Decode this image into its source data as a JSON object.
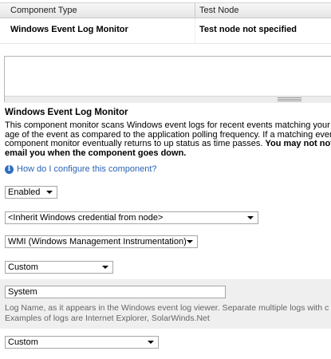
{
  "table": {
    "headers": [
      "Component Type",
      "Test Node"
    ],
    "row": {
      "component_type": "Windows Event Log Monitor",
      "test_node": "Test node not specified"
    }
  },
  "section": {
    "title": "Windows Event Log Monitor",
    "description_lines": [
      "This component monitor scans Windows event logs for recent events matching your",
      "age of the event as compared to the application polling frequency. If a matching event",
      "component monitor eventually returns to up status as time passes."
    ],
    "description_bold_tail": "You may not not",
    "description_bold_line": "email you when the component goes down.",
    "help_link": "How do I configure this component?"
  },
  "fields": {
    "status_select": "Enabled",
    "credential_select": "<Inherit Windows credential from node>",
    "protocol_select": "WMI (Windows Management Instrumentation)",
    "custom_select_1": "Custom",
    "log_name_input": "System",
    "log_hint_lines": [
      "Log Name, as it appears in the Windows event log viewer. Separate multiple logs with c",
      "Examples of logs are Internet Explorer, SolarWinds.Net"
    ],
    "custom_select_2": "Custom"
  }
}
